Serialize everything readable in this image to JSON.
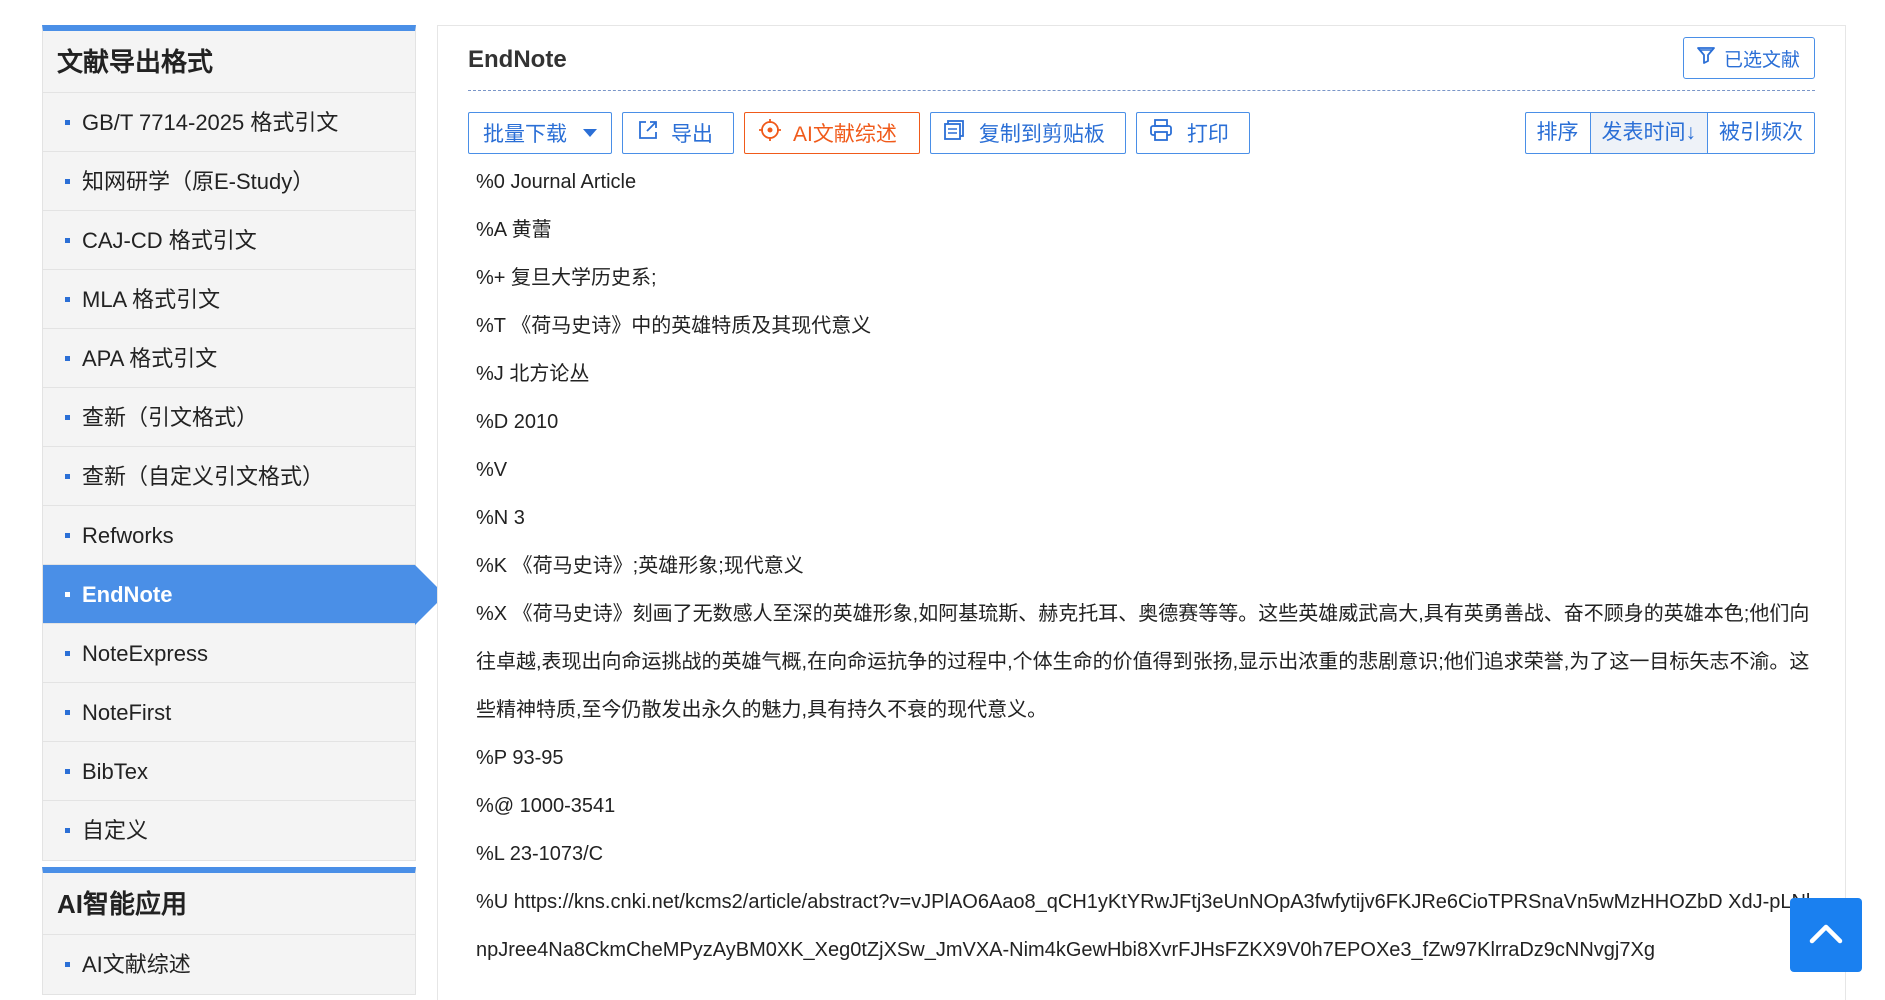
{
  "sidebar": {
    "export_title": "文献导出格式",
    "items": [
      {
        "label": "GB/T 7714-2025 格式引文"
      },
      {
        "label": "知网研学（原E-Study）"
      },
      {
        "label": "CAJ-CD 格式引文"
      },
      {
        "label": "MLA 格式引文"
      },
      {
        "label": "APA 格式引文"
      },
      {
        "label": "查新（引文格式）"
      },
      {
        "label": "查新（自定义引文格式）"
      },
      {
        "label": "Refworks"
      },
      {
        "label": "EndNote"
      },
      {
        "label": "NoteExpress"
      },
      {
        "label": "NoteFirst"
      },
      {
        "label": "BibTex"
      },
      {
        "label": "自定义"
      }
    ],
    "active_item": "EndNote",
    "ai_title": "AI智能应用",
    "ai_items": [
      {
        "label": "AI文献综述"
      }
    ]
  },
  "main": {
    "title": "EndNote",
    "selected_docs_label": "已选文献",
    "toolbar": {
      "batch_download": "批量下载",
      "export": "导出",
      "ai_review": "AI文献综述",
      "copy": "复制到剪贴板",
      "print": "打印"
    },
    "sort": {
      "label": "排序",
      "publish_time": "发表时间",
      "citations": "被引频次"
    },
    "content_lines": [
      "%0 Journal Article",
      "%A 黄蕾",
      "%+ 复旦大学历史系;",
      "%T 《荷马史诗》中的英雄特质及其现代意义",
      "%J 北方论丛",
      "%D 2010",
      "%V",
      "%N 3",
      "%K 《荷马史诗》;英雄形象;现代意义",
      "%X 《荷马史诗》刻画了无数感人至深的英雄形象,如阿基琉斯、赫克托耳、奥德赛等等。这些英雄威武高大,具有英勇善战、奋不顾身的英雄本色;他们向往卓越,表现出向命运挑战的英雄气概,在向命运抗争的过程中,个体生命的价值得到张扬,显示出浓重的悲剧意识;他们追求荣誉,为了这一目标矢志不渝。这些精神特质,至今仍散发出永久的魅力,具有持久不衰的现代意义。",
      "%P 93-95",
      "%@ 1000-3541",
      "%L 23-1073/C",
      "%U https://kns.cnki.net/kcms2/article/abstract?v=vJPlAO6Aao8_qCH1yKtYRwJFtj3eUnNOpA3fwfytijv6FKJRe6CioTPRSnaVn5wMzHHOZbD XdJ-pLNlnpJree4Na8CkmCheMPyzAyBM0XK_Xeg0tZjXSw_JmVXA-Nim4kGewHbi8XvrFJHsFZKX9V0h7EPOXe3_fZw97KlrraDz9cNNvgj7Xg"
    ]
  },
  "colors": {
    "accent": "#4a8fe7",
    "link": "#2b6fd6",
    "ai_orange": "#f05a1a",
    "back_to_top": "#1a80f0"
  },
  "icons": {
    "selected": "funnel-icon",
    "batch_download": "chevron-down-icon",
    "export": "external-link-icon",
    "ai_review": "target-icon",
    "copy": "clipboard-icon",
    "print": "printer-icon",
    "sort_dir": "arrow-down-icon",
    "back_to_top": "chevron-up-icon"
  }
}
